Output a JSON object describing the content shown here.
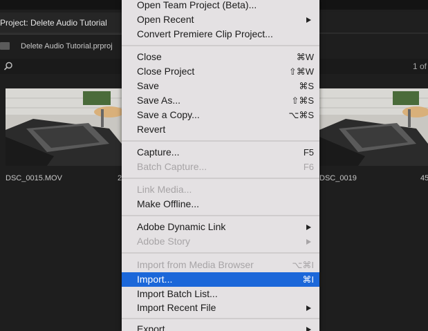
{
  "project_panel": {
    "tab_title": "Project: Delete Audio Tutorial",
    "project_file": "Delete Audio Tutorial.prproj",
    "page_count": "1 of",
    "clips": [
      {
        "name": "DSC_0015.MOV",
        "duration": "2"
      },
      {
        "name": "DSC_0019",
        "duration": "45"
      }
    ]
  },
  "file_menu": {
    "items": [
      {
        "label": "Open Team Project (Beta)...",
        "shortcut": "",
        "submenu": false,
        "disabled": false,
        "active": false
      },
      {
        "label": "Open Recent",
        "shortcut": "",
        "submenu": true,
        "disabled": false,
        "active": false
      },
      {
        "label": "Convert Premiere Clip Project...",
        "shortcut": "",
        "submenu": false,
        "disabled": false,
        "active": false
      },
      {
        "label": "Close",
        "shortcut": "⌘W",
        "submenu": false,
        "disabled": false,
        "active": false
      },
      {
        "label": "Close Project",
        "shortcut": "⇧⌘W",
        "submenu": false,
        "disabled": false,
        "active": false
      },
      {
        "label": "Save",
        "shortcut": "⌘S",
        "submenu": false,
        "disabled": false,
        "active": false
      },
      {
        "label": "Save As...",
        "shortcut": "⇧⌘S",
        "submenu": false,
        "disabled": false,
        "active": false
      },
      {
        "label": "Save a Copy...",
        "shortcut": "⌥⌘S",
        "submenu": false,
        "disabled": false,
        "active": false
      },
      {
        "label": "Revert",
        "shortcut": "",
        "submenu": false,
        "disabled": false,
        "active": false
      },
      {
        "label": "Capture...",
        "shortcut": "F5",
        "submenu": false,
        "disabled": false,
        "active": false
      },
      {
        "label": "Batch Capture...",
        "shortcut": "F6",
        "submenu": false,
        "disabled": true,
        "active": false
      },
      {
        "label": "Link Media...",
        "shortcut": "",
        "submenu": false,
        "disabled": true,
        "active": false
      },
      {
        "label": "Make Offline...",
        "shortcut": "",
        "submenu": false,
        "disabled": false,
        "active": false
      },
      {
        "label": "Adobe Dynamic Link",
        "shortcut": "",
        "submenu": true,
        "disabled": false,
        "active": false
      },
      {
        "label": "Adobe Story",
        "shortcut": "",
        "submenu": true,
        "disabled": true,
        "active": false
      },
      {
        "label": "Import from Media Browser",
        "shortcut": "⌥⌘I",
        "submenu": false,
        "disabled": true,
        "active": false
      },
      {
        "label": "Import...",
        "shortcut": "⌘I",
        "submenu": false,
        "disabled": false,
        "active": true
      },
      {
        "label": "Import Batch List...",
        "shortcut": "",
        "submenu": false,
        "disabled": false,
        "active": false
      },
      {
        "label": "Import Recent File",
        "shortcut": "",
        "submenu": true,
        "disabled": false,
        "active": false
      },
      {
        "label": "Export",
        "shortcut": "",
        "submenu": true,
        "disabled": false,
        "active": false
      }
    ]
  },
  "colors": {
    "highlight": "#1b67d9",
    "menu_background": "#e4e1e3",
    "panel_background": "#1e1e1e"
  }
}
